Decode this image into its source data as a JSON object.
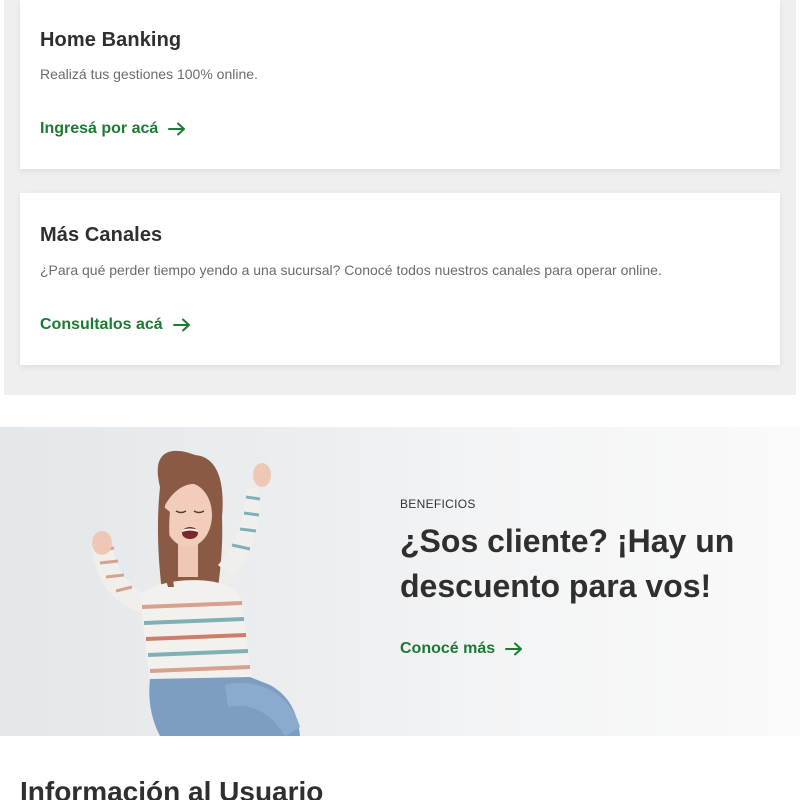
{
  "cards": [
    {
      "title": "Home Banking",
      "description": "Realizá tus gestiones 100% online.",
      "link_label": "Ingresá por acá",
      "link_icon": "arrow-right-icon"
    },
    {
      "title": "Más Canales",
      "description": "¿Para qué perder tiempo yendo a una sucursal? Conocé todos nuestros canales para operar online.",
      "link_label": "Consultalos acá",
      "link_icon": "arrow-right-icon"
    }
  ],
  "benefits": {
    "eyebrow": "BENEFICIOS",
    "title": "¿Sos cliente? ¡Hay un descuento para vos!",
    "link_label": "Conocé más",
    "link_icon": "arrow-right-icon",
    "image": "happy-woman-celebrating-photo"
  },
  "info_section": {
    "heading": "Información al Usuario"
  },
  "colors": {
    "accent_green": "#1e7a33",
    "section_gray": "#efefef",
    "text_dark": "#2f2f2f"
  }
}
